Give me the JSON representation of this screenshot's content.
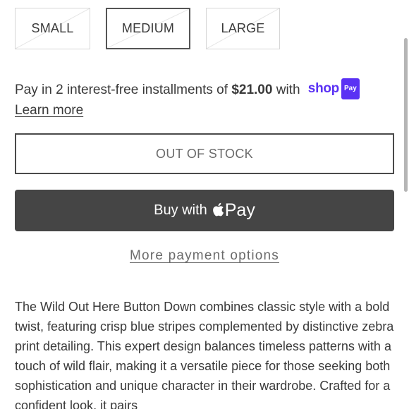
{
  "sizes": [
    {
      "label": "SMALL",
      "available": false,
      "selected": false
    },
    {
      "label": "MEDIUM",
      "available": false,
      "selected": true
    },
    {
      "label": "LARGE",
      "available": false,
      "selected": false
    }
  ],
  "installments": {
    "prefix": "Pay in 2 interest-free installments of ",
    "amount": "$21.00",
    "suffix": " with ",
    "shop_word": "shop",
    "shop_badge": "Pay",
    "learn_more": "Learn more",
    "brand_color": "#5a31f4"
  },
  "stock_button": {
    "label": "OUT OF STOCK"
  },
  "apple_pay": {
    "buy_label": "Buy with",
    "pay_label": "Pay",
    "icon": "apple-icon"
  },
  "more_payment_options": "More payment options",
  "description": "The Wild Out Here Button Down combines classic style with a bold twist, featuring crisp blue stripes complemented by distinctive zebra print detailing. This expert design balances timeless patterns with a touch of wild flair, making it a versatile piece for those seeking both sophistication and unique character in their wardrobe. Crafted for a confident look, it pairs"
}
